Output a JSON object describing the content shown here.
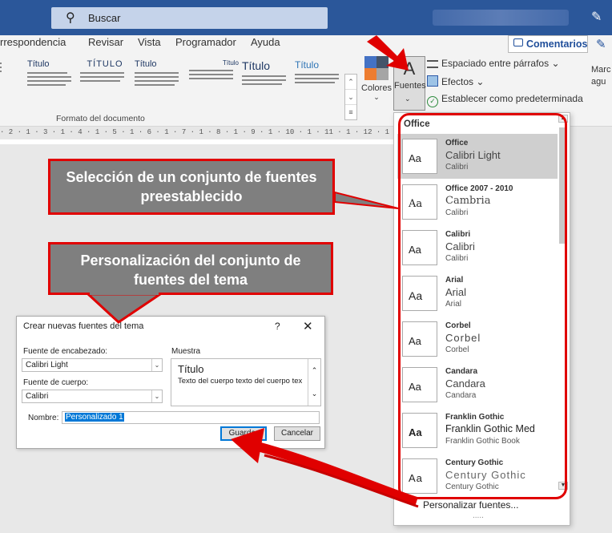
{
  "titlebar": {
    "search_label": "Buscar"
  },
  "tabs": [
    "rrespondencia",
    "Revisar",
    "Vista",
    "Programador",
    "Ayuda"
  ],
  "comments_label": "Comentarios",
  "ribbon": {
    "style_titles": [
      "Título",
      "TÍTULO",
      "Título",
      "Título",
      "Título",
      "Título",
      "Título"
    ],
    "group_label": "Formato del documento",
    "colors_label": "Colores",
    "fonts_label": "Fuentes",
    "fonts_glyph": "A",
    "spacing_label": "Espaciado entre párrafos",
    "effects_label": "Efectos",
    "default_label": "Establecer como predeterminada",
    "marca_label_1": "Marc",
    "marca_label_2": "agu"
  },
  "ruler_text": "· 2 · 1 · 3 · 1 · 4 · 1 · 5 · 1 · 6 · 1 · 7 · 1 · 8 · 1 · 9 · 1 · 10 · 1 · 11 · 1 · 12 · 1 · 13 · 1 · 14 · 1 ·",
  "callouts": {
    "preset_line1": "Selección de un conjunto de fuentes",
    "preset_line2": "preestablecido",
    "custom_line1": "Personalización del conjunto de",
    "custom_line2": "fuentes del tema"
  },
  "font_dropdown": {
    "header": "Office",
    "preview_glyph": "Aa",
    "items": [
      {
        "name": "Office",
        "heading": "Calibri Light",
        "body": "Calibri"
      },
      {
        "name": "Office 2007 - 2010",
        "heading": "Cambria",
        "body": "Calibri"
      },
      {
        "name": "Calibri",
        "heading": "Calibri",
        "body": "Calibri"
      },
      {
        "name": "Arial",
        "heading": "Arial",
        "body": "Arial"
      },
      {
        "name": "Corbel",
        "heading": "Corbel",
        "body": "Corbel"
      },
      {
        "name": "Candara",
        "heading": "Candara",
        "body": "Candara"
      },
      {
        "name": "Franklin Gothic",
        "heading": "Franklin Gothic Med",
        "body": "Franklin Gothic Book"
      },
      {
        "name": "Century Gothic",
        "heading": "Century Gothic",
        "body": "Century Gothic"
      }
    ],
    "customize_label": "Personalizar fuentes...",
    "more": "....."
  },
  "dialog": {
    "title": "Crear nuevas fuentes del tema",
    "help": "?",
    "close": "✕",
    "heading_font_label": "Fuente de encabezado:",
    "heading_font_value": "Calibri Light",
    "body_font_label": "Fuente de cuerpo:",
    "body_font_value": "Calibri",
    "sample_label": "Muestra",
    "sample_title": "Título",
    "sample_body": "Texto del cuerpo texto del cuerpo tex",
    "name_label": "Nombre:",
    "name_value": "Personalizado 1",
    "save_label": "Guardar",
    "cancel_label": "Cancelar"
  },
  "colors": {
    "accent_red": "#e00000",
    "titlebar_blue": "#2b579a",
    "callout_gray": "#7f7f7f"
  }
}
